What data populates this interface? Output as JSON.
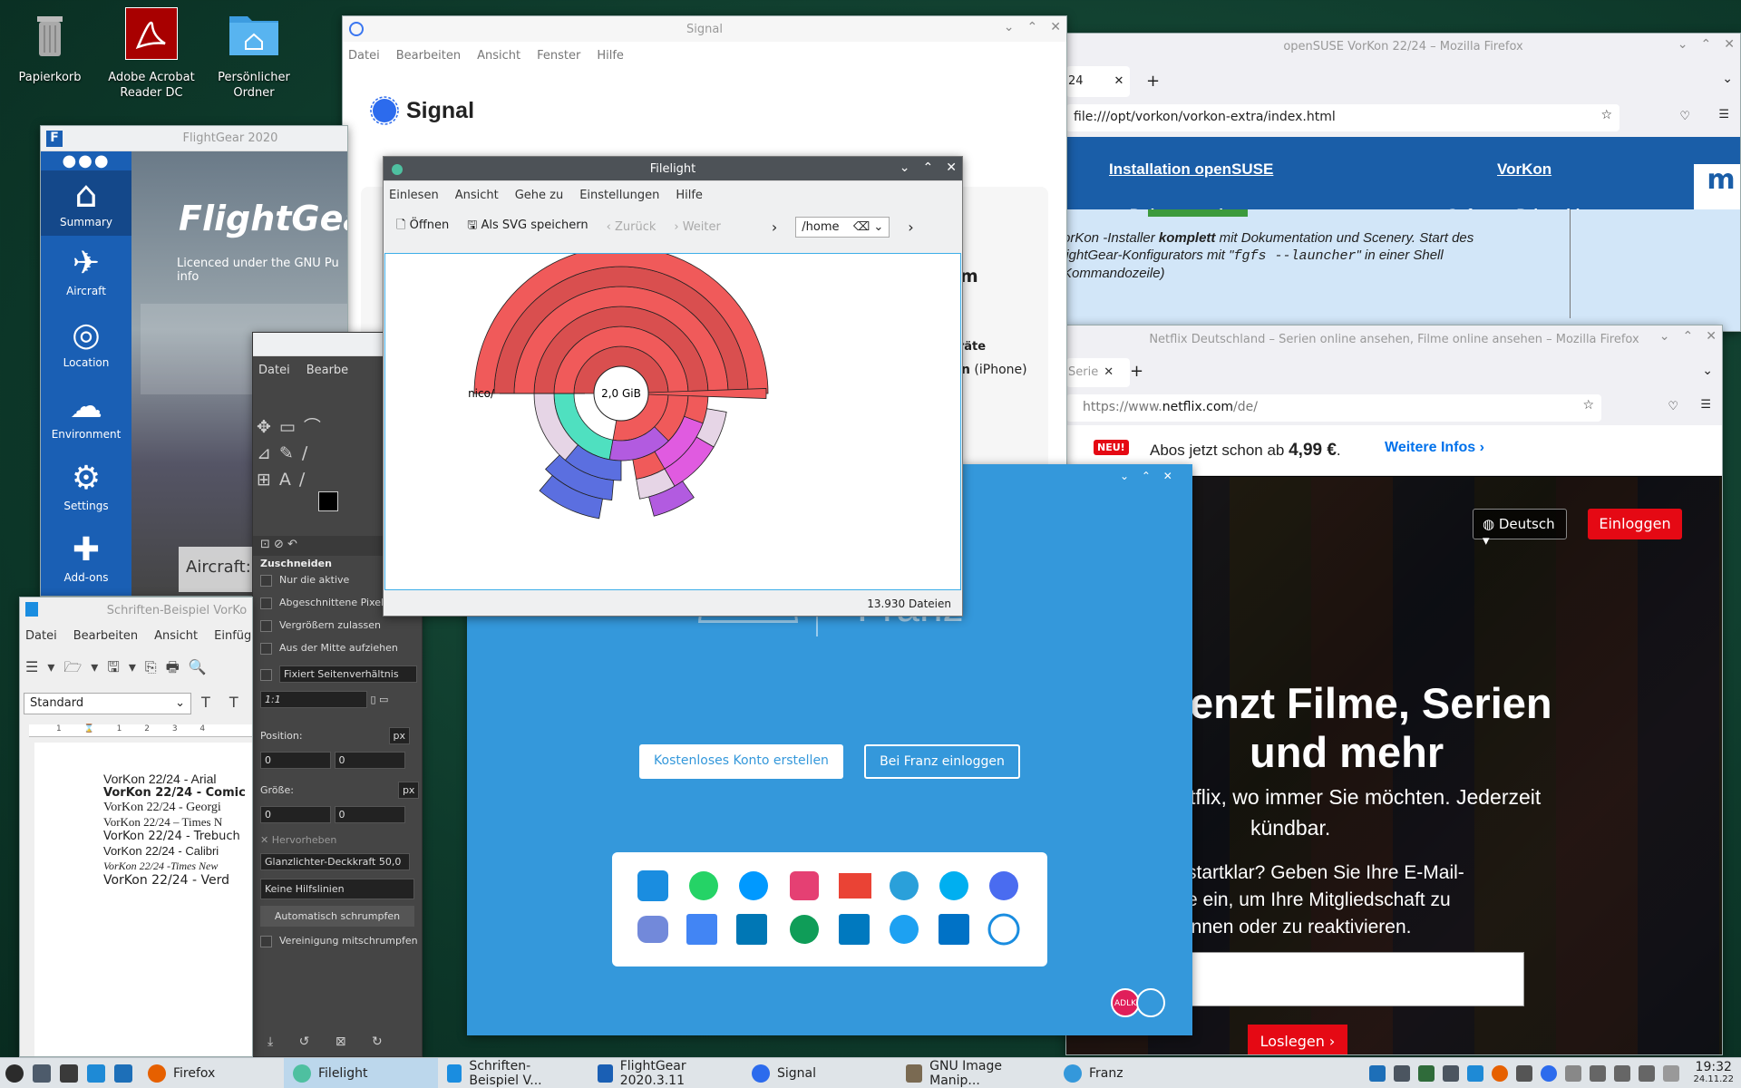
{
  "desktop": {
    "icons": [
      {
        "label": "Papierkorb"
      },
      {
        "label": "Adobe Acrobat Reader DC"
      },
      {
        "label": "Persönlicher Ordner"
      }
    ]
  },
  "firefox_opensuse": {
    "title": "openSUSE VorKon 22/24 – Mozilla Firefox",
    "tab": "24",
    "url": "file:///opt/vorkon/vorkon-extra/index.html",
    "links": [
      "Installation openSUSE",
      "VorKon",
      "Dokumentation",
      "Software Drittanbieter"
    ],
    "text_pre": "orKon -Installer ",
    "text_bold": "komplett",
    "text_post": " mit Dokumentation und Scenery. Start des",
    "text2_pre": "lightGear-Konfigurators mit \"",
    "text2_code": "fgfs --launcher",
    "text2_post": "\" in einer Shell",
    "text3": "Kommandozeile)"
  },
  "firefox_netflix": {
    "title": "Netflix Deutschland – Serien online ansehen, Filme online ansehen – Mozilla Firefox",
    "tab": "Serie",
    "url_pre": "https://www.",
    "url_host": "netflix.com",
    "url_post": "/de/",
    "badge": "NEU!",
    "promo_pre": "Abos jetzt schon ab ",
    "promo_price": "4,99 €",
    "promo_post": ".",
    "more": "Weitere Infos",
    "lang": "Deutsch",
    "login": "Einloggen",
    "hero1": "enzt Filme, Serien",
    "hero2": "und mehr",
    "sub1": "tflix, wo immer Sie möchten. Jederzeit",
    "sub2": "kündbar.",
    "email1": "startklar? Geben Sie Ihre E-Mail-",
    "email2": "e ein, um Ihre Mitgliedschaft zu",
    "email3": "innen oder zu reaktivieren.",
    "start": "Loslegen"
  },
  "signal": {
    "title": "Signal",
    "menu": [
      "Datei",
      "Bearbeiten",
      "Ansicht",
      "Fenster",
      "Hilfe"
    ],
    "brand": "Signal",
    "heading": "em",
    "devices": "eräte",
    "iphone_bold": "n",
    "iphone": " (iPhone)"
  },
  "flightgear": {
    "title": "FlightGear 2020",
    "nav": [
      "Summary",
      "Aircraft",
      "Location",
      "Environment",
      "Settings",
      "Add-ons"
    ],
    "logo": "FlightGear",
    "licence1": "Licenced under the GNU Pu",
    "licence2": "info",
    "aircraft": "Aircraft:"
  },
  "gimp": {
    "menu": [
      "Datei",
      "Bearbe"
    ],
    "section": "Zuschneiden",
    "opt1": "Nur die aktive",
    "opt2": "Abgeschnittene Pixel",
    "opt3": "Vergrößern zulassen",
    "opt4": "Aus der Mitte aufziehen",
    "fixed": "Fixiert Seitenverhältnis",
    "ratio": "1:1",
    "pos": "Position:",
    "unit": "px",
    "size": "Größe:",
    "zero": "0",
    "highlight": "Hervorheben",
    "opacity_label": "Glanzlichter-Deckkraft",
    "opacity": "50,0",
    "guides": "Keine Hilfslinien",
    "autoshrink": "Automatisch schrumpfen",
    "merge": "Vereinigung mitschrumpfen"
  },
  "writer": {
    "title": "Schriften-Beispiel VorKo",
    "menu": [
      "Datei",
      "Bearbeiten",
      "Ansicht",
      "Einfüge"
    ],
    "style": "Standard",
    "lines": [
      "VorKon 22/24 - Arial",
      "VorKon 22/24 - Comic",
      "VorKon 22/24 - Georgi",
      "VorKon 22/24 – Times N",
      "VorKon 22/24 - Trebuch",
      "VorKon 22/24 - Calibri",
      "VorKon 22/24 -Times New",
      "VorKon 22/24 - Verd"
    ]
  },
  "franz": {
    "create": "Kostenloses Konto erstellen",
    "login": "Bei Franz einloggen",
    "brand": "Franz",
    "avatar": "ADLK"
  },
  "filelight": {
    "title": "Filelight",
    "menu": [
      "Einlesen",
      "Ansicht",
      "Gehe zu",
      "Einstellungen",
      "Hilfe"
    ],
    "open": "Öffnen",
    "save": "Als SVG speichern",
    "back": "Zurück",
    "forward": "Weiter",
    "path": "/home",
    "center": "2,0 GiB",
    "label": "nico/",
    "status": "13.930 Dateien",
    "colors": {
      "red": "#f05a5a",
      "darkred": "#d94f4f",
      "teal": "#4fe0c0",
      "blue": "#5b6fe0",
      "purple": "#b25be0",
      "magenta": "#e05be0",
      "pale": "#e6d5e6"
    }
  },
  "taskbar": {
    "items": [
      "Firefox",
      "Filelight",
      "Schriften-Beispiel V...",
      "FlightGear 2020.3.11",
      "Signal",
      "GNU Image Manip...",
      "Franz"
    ],
    "time": "19:32",
    "date": "24.11.22"
  }
}
